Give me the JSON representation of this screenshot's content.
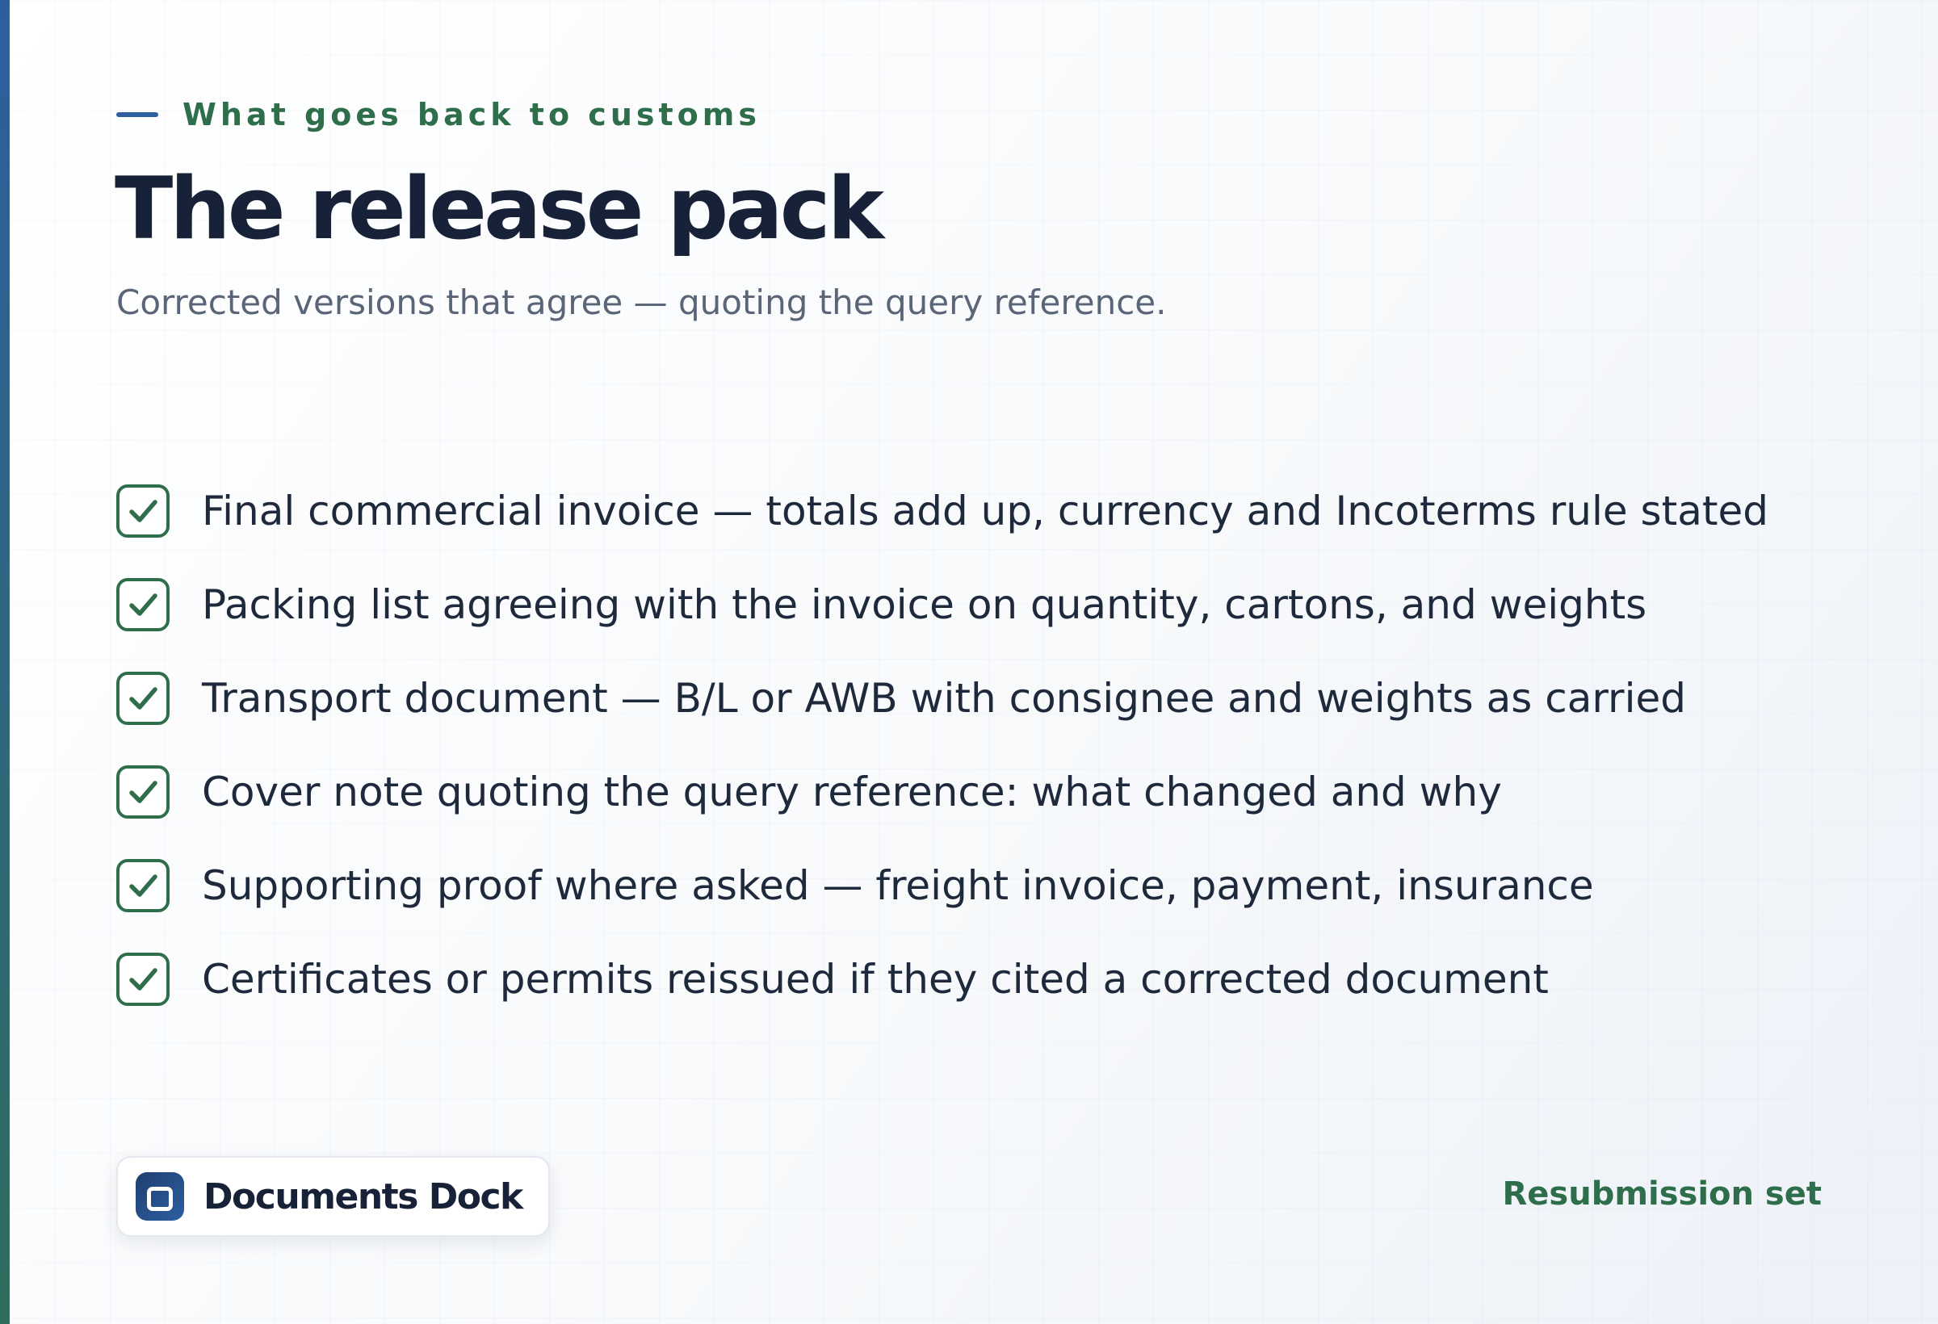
{
  "header": {
    "eyebrow": "What goes back to customs",
    "title": "The release pack",
    "subtitle": "Corrected versions that agree — quoting the query reference."
  },
  "checklist": {
    "items": [
      {
        "label": "Final commercial invoice — totals add up, currency and Incoterms rule stated",
        "checked": true
      },
      {
        "label": "Packing list agreeing with the invoice on quantity, cartons, and weights",
        "checked": true
      },
      {
        "label": "Transport document — B/L or AWB with consignee and weights as carried",
        "checked": true
      },
      {
        "label": "Cover note quoting the query reference: what changed and why",
        "checked": true
      },
      {
        "label": "Supporting proof where asked — freight invoice, payment, insurance",
        "checked": true
      },
      {
        "label": "Certificates or permits reissued if they cited a corrected document",
        "checked": true
      }
    ],
    "icon": "checkbox-checked-icon"
  },
  "footer": {
    "brand_name": "Documents Dock",
    "brand_icon": "documents-dock-logo-icon",
    "label": "Resubmission set"
  },
  "colors": {
    "accent_green": "#2e6e4a",
    "accent_blue": "#2d5fa0",
    "title_navy": "#172238"
  }
}
